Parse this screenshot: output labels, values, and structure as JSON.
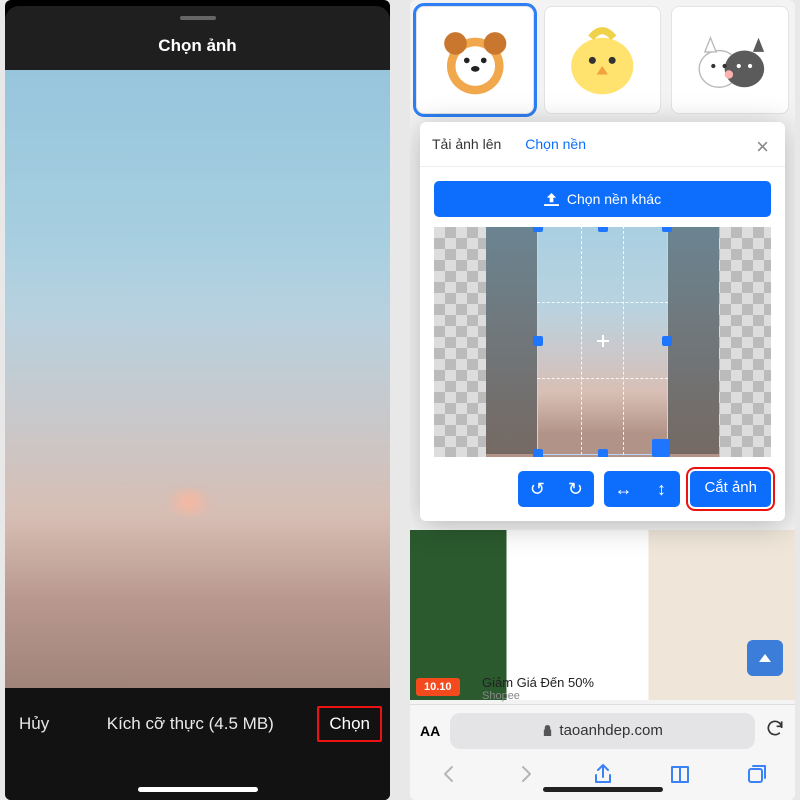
{
  "left": {
    "title": "Chọn ảnh",
    "size_label": "Kích cỡ thực (4.5 MB)",
    "cancel": "Hủy",
    "choose": "Chọn"
  },
  "right": {
    "modal": {
      "tab_upload": "Tải ảnh lên",
      "tab_background": "Chọn nền",
      "choose_other_bg": "Chọn nền khác",
      "crop_button": "Cắt ảnh",
      "close_symbol": "×"
    },
    "ad": {
      "badge": "10.10",
      "headline": "Giảm Giá Đến 50%",
      "source": "Shopee"
    },
    "safari": {
      "aa": "AA",
      "domain": "taoanhdep.com"
    },
    "tool_icons": {
      "undo": "↺",
      "redo": "↻",
      "fliph": "↔",
      "flipv": "↕"
    }
  }
}
